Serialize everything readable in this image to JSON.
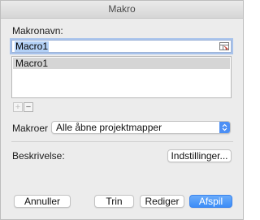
{
  "window": {
    "title": "Makro"
  },
  "macro_name": {
    "label": "Makronavn:",
    "value": "Macro1",
    "ref_icon": "range-select-icon"
  },
  "macro_list": {
    "items": [
      "Macro1"
    ],
    "selected_index": 0
  },
  "list_controls": {
    "add_label": "+",
    "remove_label": "−"
  },
  "macros_in": {
    "label": "Makroer i:",
    "selected": "Alle åbne projektmapper"
  },
  "description": {
    "label": "Beskrivelse:",
    "options_button": "Indstillinger..."
  },
  "footer": {
    "cancel": "Annuller",
    "step": "Trin",
    "edit": "Rediger",
    "run": "Afspil"
  },
  "colors": {
    "accent": "#3c8df7",
    "selection": "#b3d0f5",
    "list_selection": "#d5d5d5"
  }
}
